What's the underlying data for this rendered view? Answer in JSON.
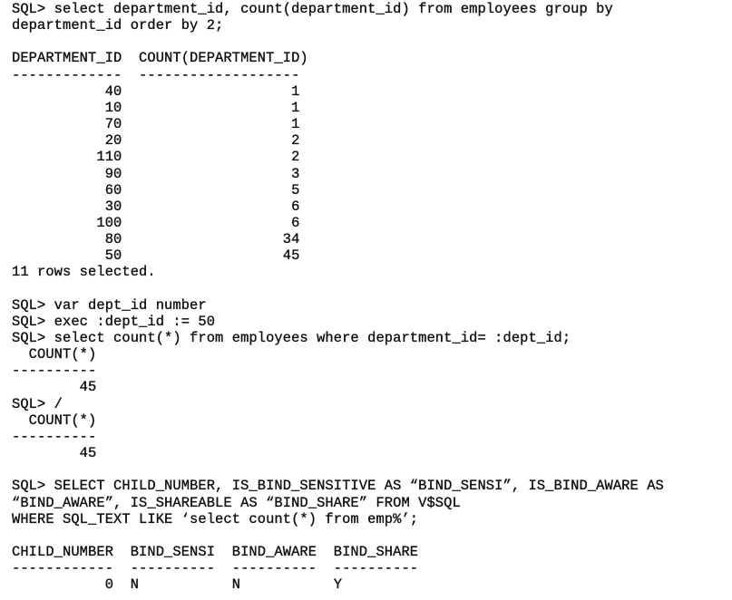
{
  "terminal": {
    "lines": [
      {
        "text": "SQL> select department_id, count(department_id) from employees group by",
        "row": 0
      },
      {
        "text": "department_id order by 2;",
        "row": 1
      },
      {
        "text": "",
        "row": 2
      },
      {
        "text": "DEPARTMENT_ID  COUNT(DEPARTMENT_ID)",
        "row": 3
      },
      {
        "text": "-------------  -------------------",
        "row": 4
      },
      {
        "text": "           40                    1",
        "row": 5
      },
      {
        "text": "           10                    1",
        "row": 6
      },
      {
        "text": "           70                    1",
        "row": 7
      },
      {
        "text": "           20                    2",
        "row": 8
      },
      {
        "text": "          110                    2",
        "row": 9
      },
      {
        "text": "           90                    3",
        "row": 10
      },
      {
        "text": "           60                    5",
        "row": 11
      },
      {
        "text": "           30                    6",
        "row": 12
      },
      {
        "text": "          100                    6",
        "row": 13
      },
      {
        "text": "           80                   34",
        "row": 14
      },
      {
        "text": "           50                   45",
        "row": 15
      },
      {
        "text": "11 rows selected.",
        "row": 16
      },
      {
        "text": "",
        "row": 17
      },
      {
        "text": "SQL> var dept_id number",
        "row": 18
      },
      {
        "text": "SQL> exec :dept_id := 50",
        "row": 19
      },
      {
        "text": "SQL> select count(*) from employees where department_id= :dept_id;",
        "row": 20
      },
      {
        "text": "  COUNT(*)",
        "row": 21
      },
      {
        "text": "----------",
        "row": 22
      },
      {
        "text": "        45",
        "row": 23
      },
      {
        "text": "SQL> /",
        "row": 24
      },
      {
        "text": "  COUNT(*)",
        "row": 25
      },
      {
        "text": "----------",
        "row": 26
      },
      {
        "text": "        45",
        "row": 27
      },
      {
        "text": "",
        "row": 28
      },
      {
        "text": "SQL> SELECT CHILD_NUMBER, IS_BIND_SENSITIVE AS “BIND_SENSI”, IS_BIND_AWARE AS",
        "row": 29
      },
      {
        "text": "“BIND_AWARE”, IS_SHAREABLE AS “BIND_SHARE” FROM V$SQL",
        "row": 30
      },
      {
        "text": "WHERE SQL_TEXT LIKE ‘select count(*) from emp%’;",
        "row": 31
      },
      {
        "text": "",
        "row": 32
      },
      {
        "text": "CHILD_NUMBER  BIND_SENSI  BIND_AWARE  BIND_SHARE",
        "row": 33
      },
      {
        "text": "------------  ----------  ----------  ----------",
        "row": 34
      },
      {
        "text": "           0  N           N           Y",
        "row": 35
      }
    ]
  },
  "query1": {
    "command": "select department_id, count(department_id) from employees group by department_id order by 2;",
    "columns": [
      "DEPARTMENT_ID",
      "COUNT(DEPARTMENT_ID)"
    ],
    "rows": [
      [
        40,
        1
      ],
      [
        10,
        1
      ],
      [
        70,
        1
      ],
      [
        20,
        2
      ],
      [
        110,
        2
      ],
      [
        90,
        3
      ],
      [
        60,
        5
      ],
      [
        30,
        6
      ],
      [
        100,
        6
      ],
      [
        80,
        34
      ],
      [
        50,
        45
      ]
    ],
    "footer": "11 rows selected."
  },
  "bind_commands": [
    "var dept_id number",
    "exec :dept_id := 50"
  ],
  "query2": {
    "command": "select count(*) from employees where department_id= :dept_id;",
    "columns": [
      "COUNT(*)"
    ],
    "result": 45
  },
  "query2_rerun": {
    "command": "/",
    "columns": [
      "COUNT(*)"
    ],
    "result": 45
  },
  "query3": {
    "command": "SELECT CHILD_NUMBER, IS_BIND_SENSITIVE AS “BIND_SENSI”, IS_BIND_AWARE AS “BIND_AWARE”, IS_SHAREABLE AS “BIND_SHARE” FROM V$SQL WHERE SQL_TEXT LIKE ‘select count(*) from emp%’;",
    "columns": [
      "CHILD_NUMBER",
      "BIND_SENSI",
      "BIND_AWARE",
      "BIND_SHARE"
    ],
    "rows": [
      [
        0,
        "N",
        "N",
        "Y"
      ]
    ]
  },
  "colors": {
    "background": "#ffffff",
    "text": "#111111"
  }
}
